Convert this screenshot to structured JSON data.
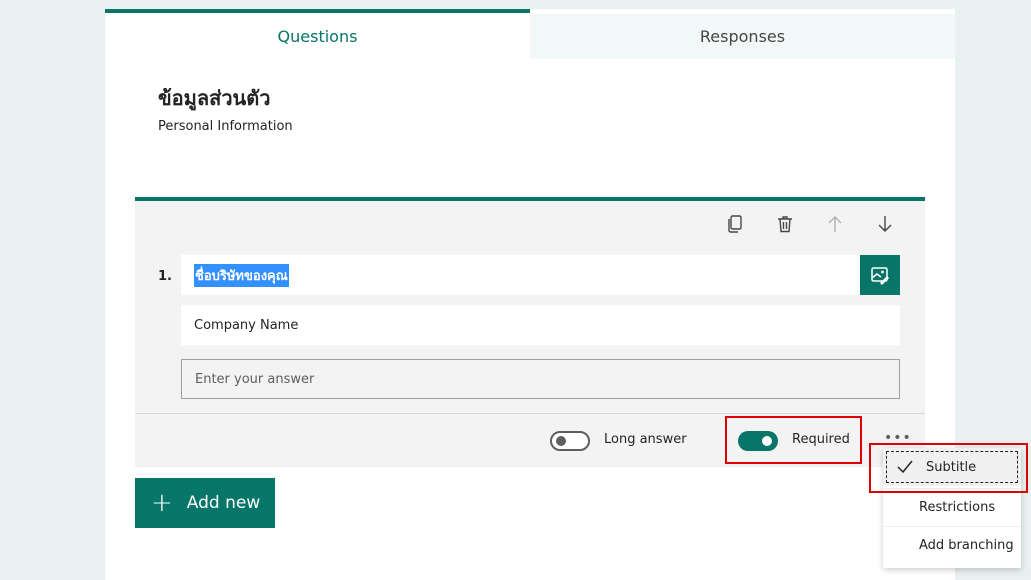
{
  "tabs": [
    {
      "label": "Questions",
      "active": true
    },
    {
      "label": "Responses",
      "active": false
    }
  ],
  "form": {
    "title": "ข้อมูลส่วนตัว",
    "subtitle": "Personal Information"
  },
  "question": {
    "number": "1.",
    "title": "ชื่อบริษัทของคุณ",
    "subtitle": "Company Name",
    "answer_placeholder": "Enter your answer",
    "long_answer_label": "Long answer",
    "long_answer_on": false,
    "required_label": "Required",
    "required_on": true,
    "tools": [
      "copy-icon",
      "delete-icon",
      "move-up-icon",
      "move-down-icon"
    ]
  },
  "add_new_label": "Add new",
  "more_menu": {
    "icon": "ellipsis-icon",
    "items": [
      {
        "label": "Subtitle",
        "checked": true
      },
      {
        "label": "Restrictions",
        "checked": false
      },
      {
        "label": "Add branching",
        "checked": false
      }
    ]
  },
  "colors": {
    "accent": "#077568",
    "highlight": "#e00000",
    "selection": "#3390ff",
    "background": "#e9f0f1"
  }
}
